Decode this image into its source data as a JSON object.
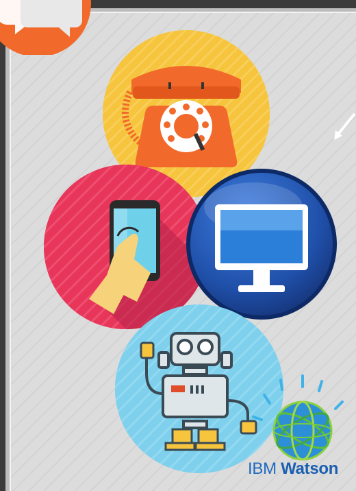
{
  "brand": {
    "company": "IBM",
    "product": "Watson"
  },
  "icons": [
    "speech-bubble-icon",
    "telephone-icon",
    "smartphone-icon",
    "monitor-icon",
    "robot-icon",
    "arrow-icon",
    "watson-globe-icon"
  ],
  "colors": {
    "phone_bg": "#f6c43d",
    "mobile_bg": "#e8365a",
    "monitor_bg": "#1f4fa8",
    "robot_bg": "#7fd0ec",
    "speech_bg": "#f26a2b",
    "brand_blue": "#1f6ac1"
  }
}
